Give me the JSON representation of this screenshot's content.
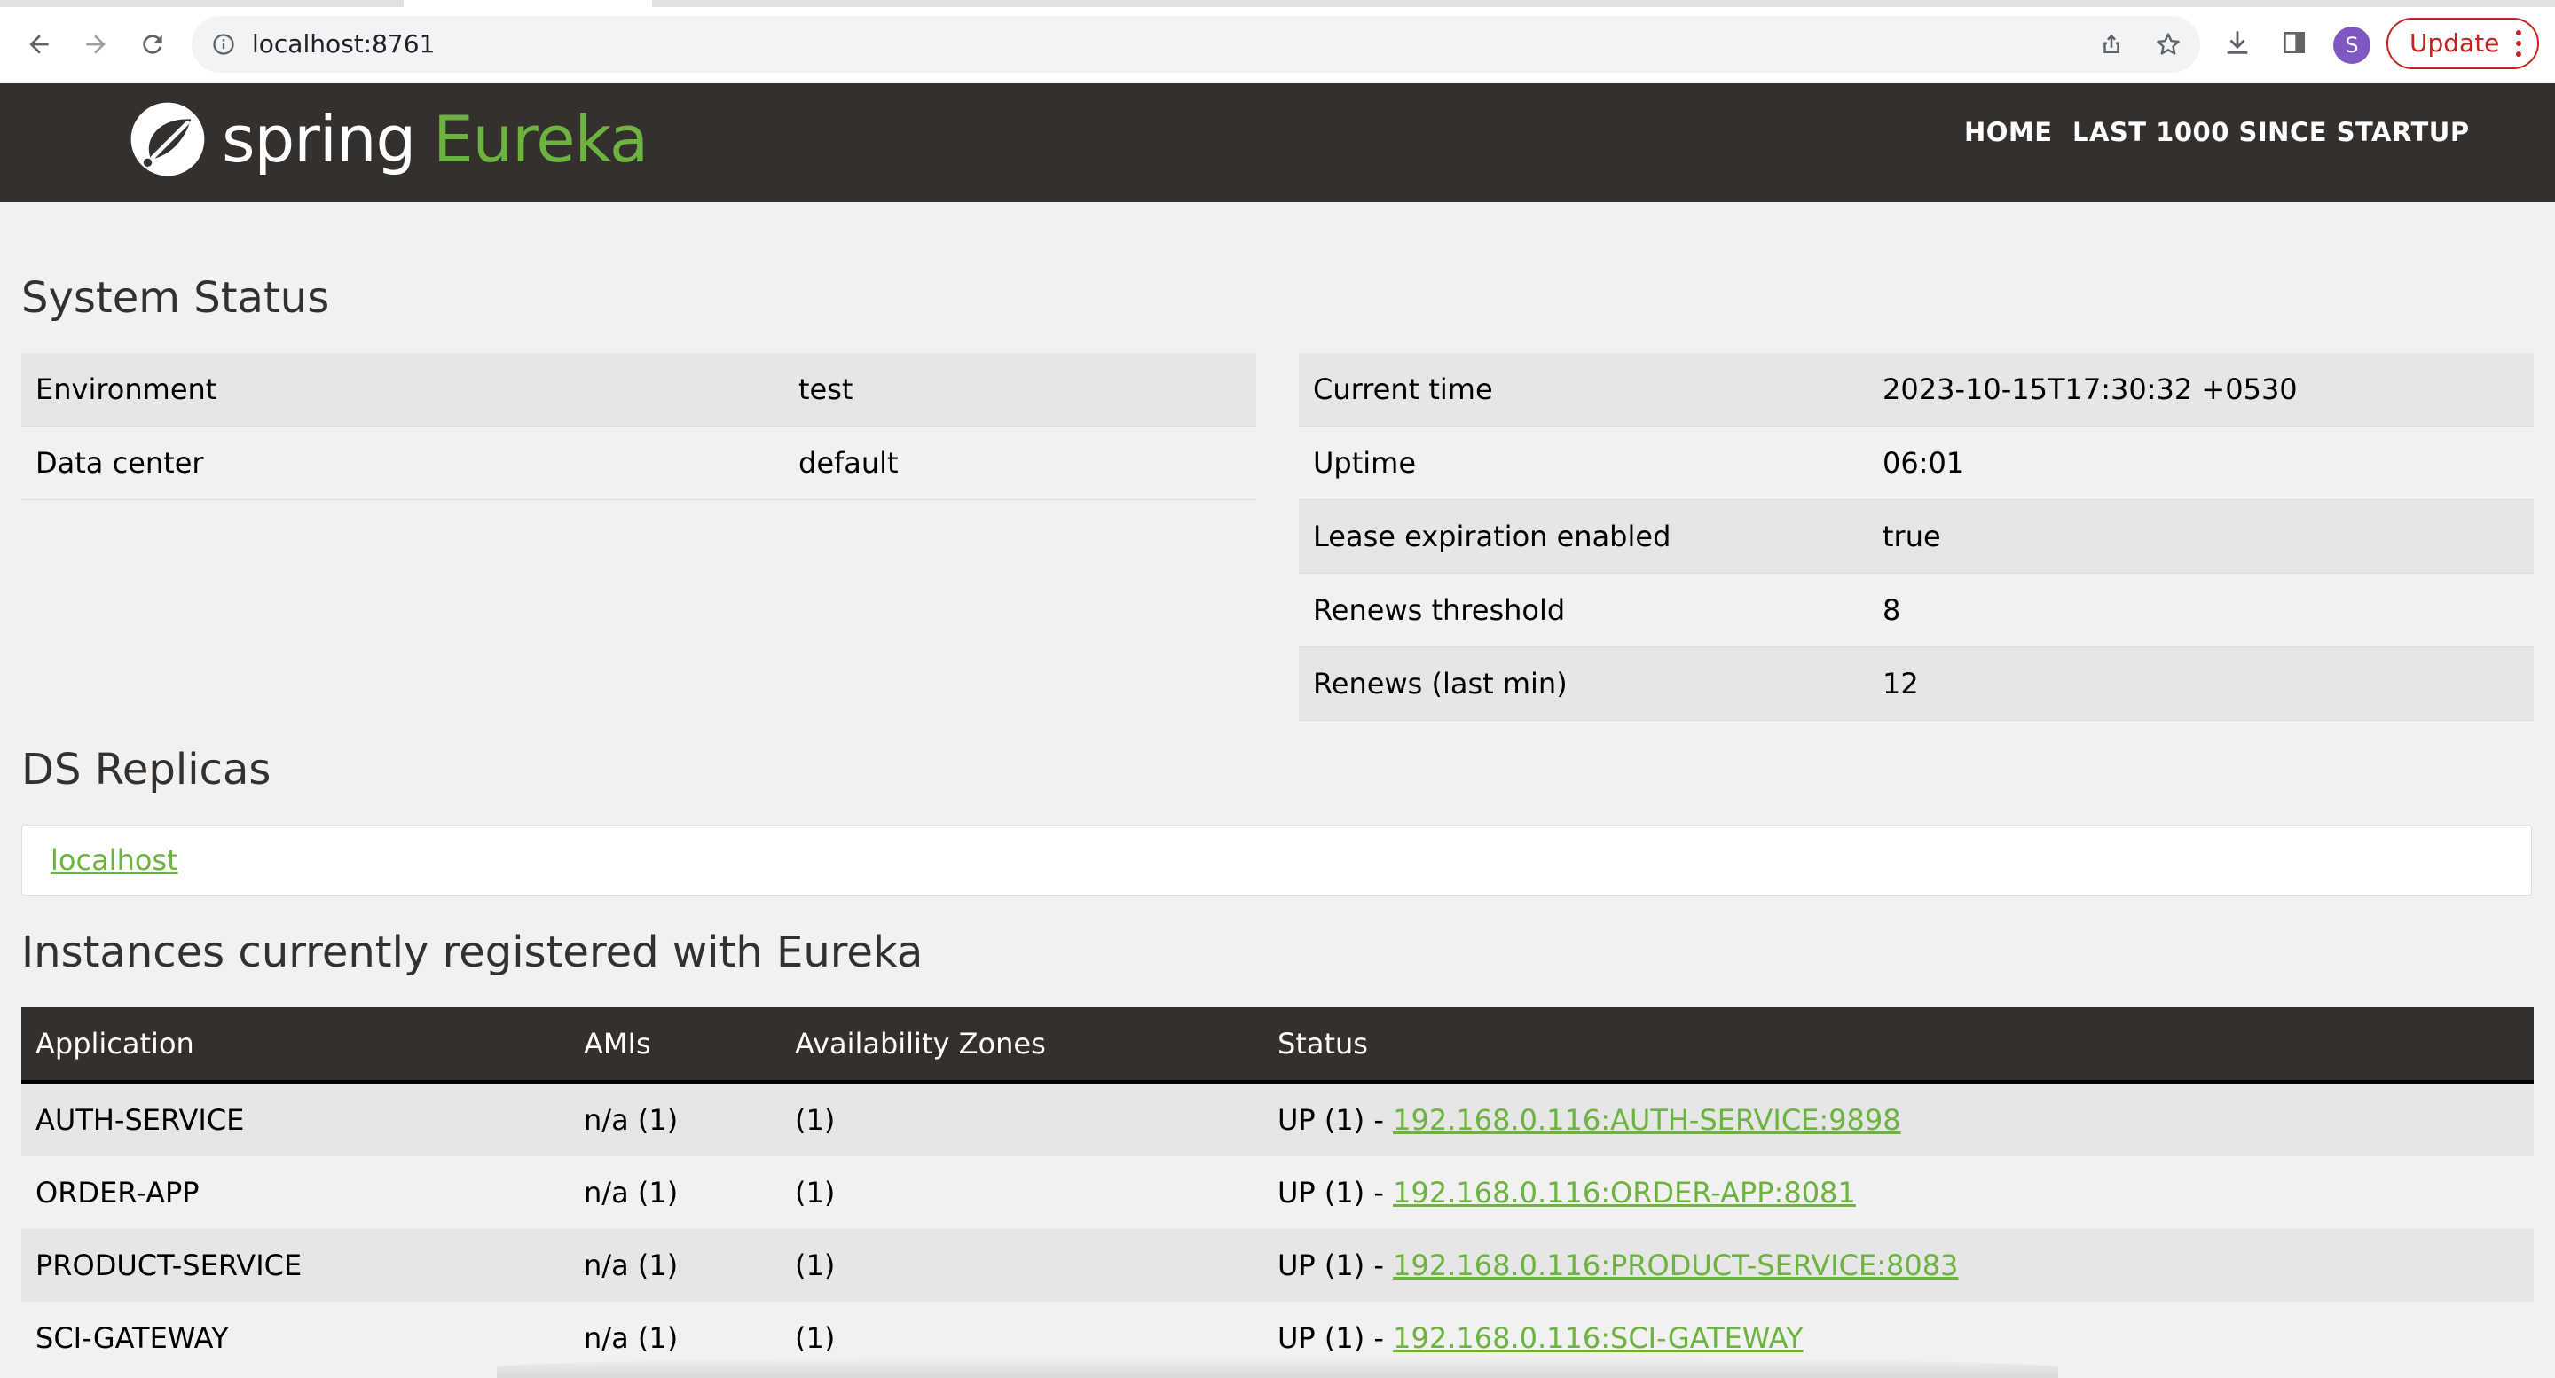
{
  "browser": {
    "url": "localhost:8761",
    "profile_initial": "S",
    "update_label": "Update",
    "icons": [
      "back-arrow-icon",
      "forward-arrow-icon",
      "reload-icon",
      "info-icon",
      "share-icon",
      "star-icon",
      "download-icon",
      "side-panel-icon",
      "kebab-menu-icon"
    ]
  },
  "nav": {
    "logo_spring": "spring",
    "logo_eureka": "Eureka",
    "home": "HOME",
    "last1000": "LAST 1000 SINCE STARTUP"
  },
  "system_status": {
    "title": "System Status",
    "left": [
      {
        "label": "Environment",
        "value": "test"
      },
      {
        "label": "Data center",
        "value": "default"
      }
    ],
    "right": [
      {
        "label": "Current time",
        "value": "2023-10-15T17:30:32 +0530"
      },
      {
        "label": "Uptime",
        "value": "06:01"
      },
      {
        "label": "Lease expiration enabled",
        "value": "true"
      },
      {
        "label": "Renews threshold",
        "value": "8"
      },
      {
        "label": "Renews (last min)",
        "value": "12"
      }
    ]
  },
  "ds_replicas": {
    "title": "DS Replicas",
    "link": "localhost"
  },
  "instances": {
    "title": "Instances currently registered with Eureka",
    "headers": [
      "Application",
      "AMIs",
      "Availability Zones",
      "Status"
    ],
    "rows": [
      {
        "app": "AUTH-SERVICE",
        "amis": "n/a (1)",
        "zones": "(1)",
        "status_prefix": "UP (1) - ",
        "link": "192.168.0.116:AUTH-SERVICE:9898"
      },
      {
        "app": "ORDER-APP",
        "amis": "n/a (1)",
        "zones": "(1)",
        "status_prefix": "UP (1) - ",
        "link": "192.168.0.116:ORDER-APP:8081"
      },
      {
        "app": "PRODUCT-SERVICE",
        "amis": "n/a (1)",
        "zones": "(1)",
        "status_prefix": "UP (1) - ",
        "link": "192.168.0.116:PRODUCT-SERVICE:8083"
      },
      {
        "app": "SCI-GATEWAY",
        "amis": "n/a (1)",
        "zones": "(1)",
        "status_prefix": "UP (1) - ",
        "link": "192.168.0.116:SCI-GATEWAY"
      }
    ]
  },
  "colors": {
    "accent_green": "#6db33f",
    "navbar_bg": "#34302d",
    "page_bg": "#f1f1f1",
    "stripe": "#e6e6e6",
    "update_red": "#c5221f",
    "avatar_purple": "#7e57c2"
  }
}
